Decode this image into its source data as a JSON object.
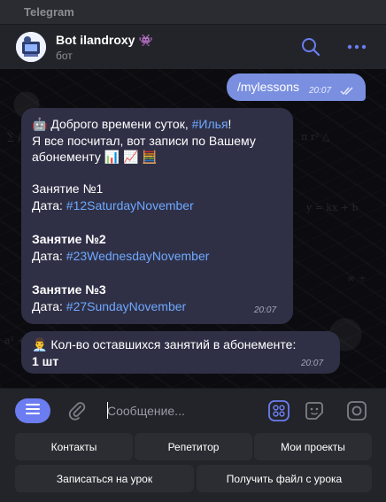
{
  "app": {
    "title": "Telegram"
  },
  "header": {
    "bot_name": "Bot ilandroxy",
    "bot_emoji": "👾",
    "subtitle": "бот"
  },
  "messages": {
    "outgoing": {
      "text": "/mylessons",
      "time": "20:07"
    },
    "schedule": {
      "line1_emoji": "🤖",
      "greeting": "Доброго времени суток,",
      "name_tag": "#Илья",
      "excl": "!",
      "line2": "Я все посчитал, вот записи по Вашему",
      "line3": "абонементу",
      "line3_emojis": "📊 📈 🧮",
      "lessons": [
        {
          "title": "Занятие №1",
          "date_label": "Дата:",
          "date_tag": "#12SaturdayNovember"
        },
        {
          "title": "Занятие №2",
          "date_label": "Дата:",
          "date_tag": "#23WednesdayNovember"
        },
        {
          "title": "Занятие №3",
          "date_label": "Дата:",
          "date_tag": "#27SundayNovember"
        }
      ],
      "time": "20:07"
    },
    "remaining": {
      "emoji": "👨‍💼",
      "text": "Кол-во оставшихся занятий в абонементе:",
      "value": "1 шт",
      "time": "20:07"
    }
  },
  "composer": {
    "placeholder": "Сообщение...",
    "value": ""
  },
  "keyboard": {
    "row1": [
      "Контакты",
      "Репетитор",
      "Мои проекты"
    ],
    "row2": [
      "Записаться на урок",
      "Получить файл с урока"
    ]
  },
  "colors": {
    "accent": "#6b7df0",
    "outgoing_bubble": "#7a8fe0",
    "incoming_bubble": "#2f3046",
    "link": "#6fa8ff"
  },
  "icons": {
    "header": [
      "search-icon",
      "more-icon"
    ],
    "composer": [
      "menu-icon",
      "attach-icon",
      "apps-icon",
      "sticker-icon",
      "camera-icon"
    ]
  }
}
